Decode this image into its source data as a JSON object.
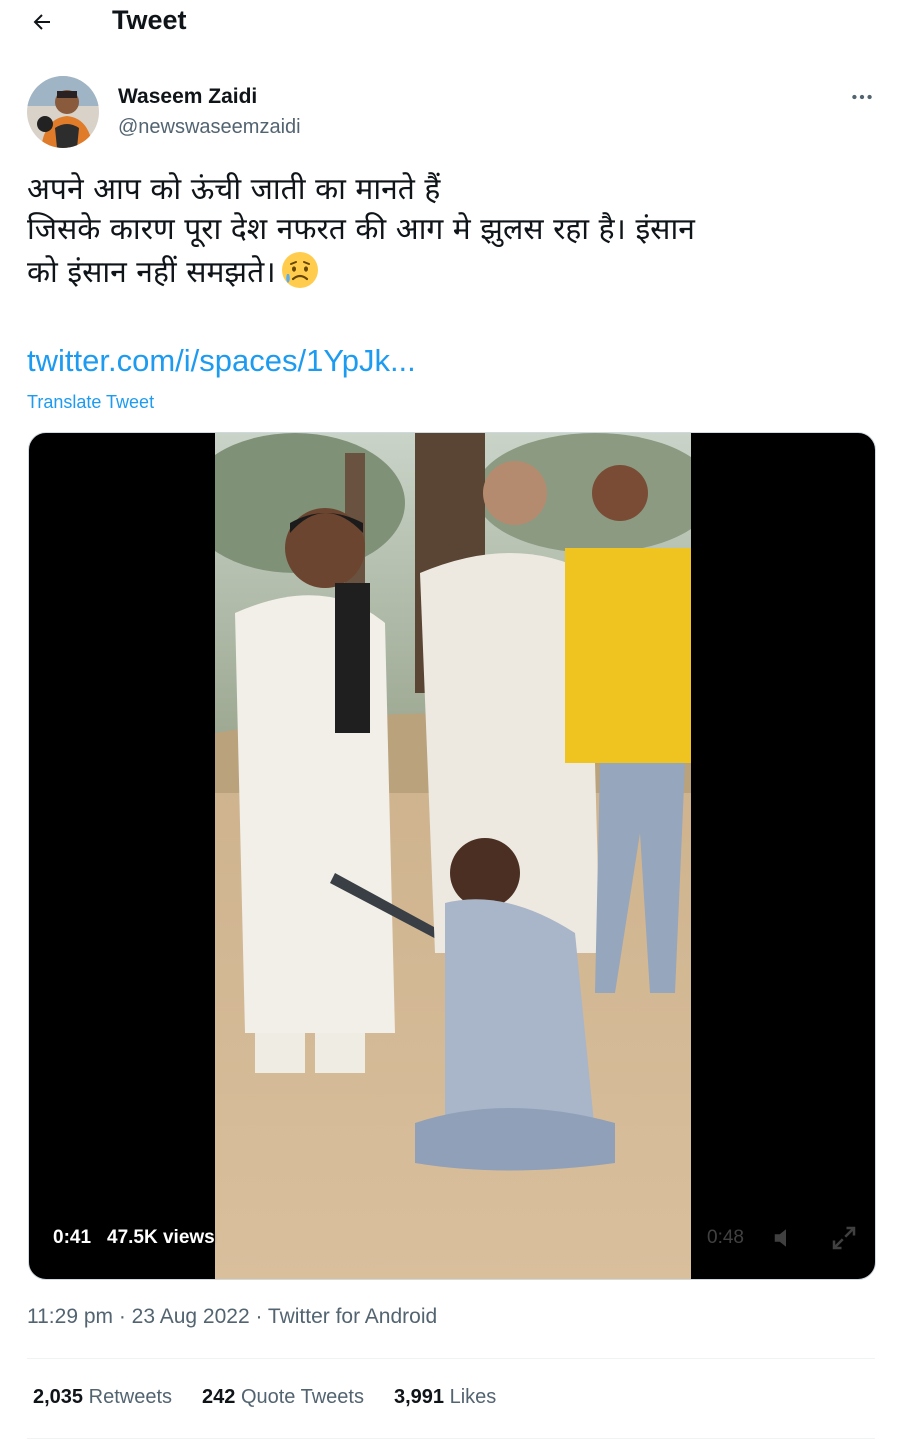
{
  "header": {
    "title": "Tweet"
  },
  "author": {
    "name": "Waseem Zaidi",
    "handle": "@newswaseemzaidi"
  },
  "tweet": {
    "lines": [
      "अपने आप को ऊंची जाती का मानते हैं",
      "जिसके कारण पूरा देश नफरत की आग मे झुलस रहा है। इंसान",
      "को इंसान नहीं समझते।"
    ],
    "emoji": "sad-but-relieved-face",
    "link": "twitter.com/i/spaces/1YpJk...",
    "translate_label": "Translate Tweet"
  },
  "video": {
    "elapsed": "0:41",
    "views": "47.5K views",
    "remaining": "0:48"
  },
  "meta": {
    "time": "11:29 pm",
    "separator": " · ",
    "date": "23 Aug 2022",
    "source": "Twitter for Android"
  },
  "stats": {
    "retweets_count": "2,035",
    "retweets_label": "Retweets",
    "quotes_count": "242",
    "quotes_label": "Quote Tweets",
    "likes_count": "3,991",
    "likes_label": "Likes"
  },
  "colors": {
    "accent": "#1d9bf0",
    "secondary_text": "#536471",
    "primary_text": "#0f1419"
  }
}
